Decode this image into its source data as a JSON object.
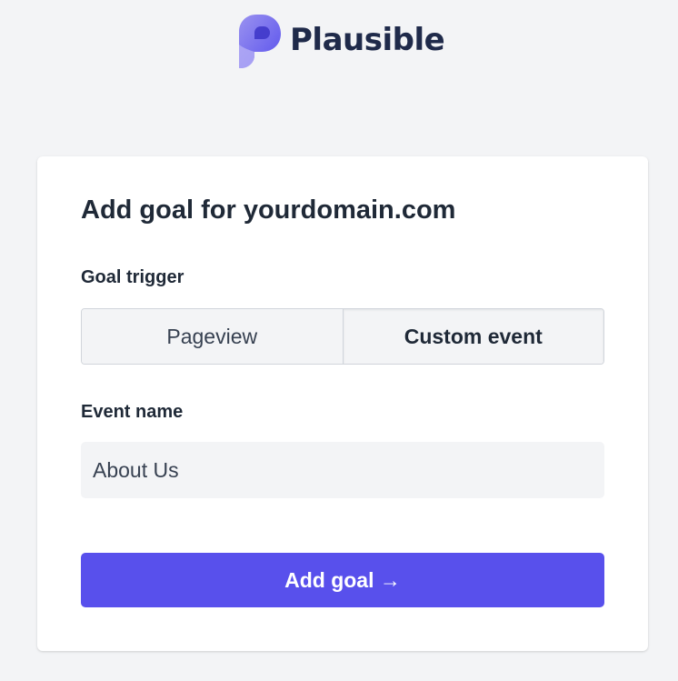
{
  "brand": {
    "name": "Plausible",
    "logo_icon": "plausible-logo-icon",
    "text_color": "#1f2a4a"
  },
  "form": {
    "title": "Add goal for yourdomain.com",
    "goal_trigger": {
      "label": "Goal trigger",
      "options": [
        "Pageview",
        "Custom event"
      ],
      "selected": "Custom event"
    },
    "event_name": {
      "label": "Event name",
      "value": "About Us"
    },
    "submit_label": "Add goal →"
  },
  "colors": {
    "background": "#f3f4f6",
    "card": "#ffffff",
    "accent": "#5850ec",
    "text": "#1f2937"
  }
}
